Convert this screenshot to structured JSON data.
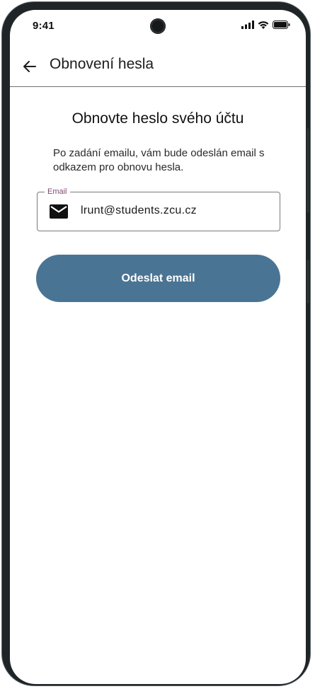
{
  "status_bar": {
    "time": "9:41"
  },
  "app_bar": {
    "back_icon": "arrow-left-icon",
    "title": "Obnovení hesla"
  },
  "content": {
    "heading": "Obnovte heslo svého účtu",
    "description": "Po zadání emailu, vám bude odeslán email s odkazem pro obnovu hesla."
  },
  "email_field": {
    "label": "Email",
    "icon": "mail-icon",
    "value": "lrunt@students.zcu.cz"
  },
  "submit_button": {
    "label": "Odeslat email"
  },
  "colors": {
    "primary": "#4a7494",
    "field_label": "#7d4b72",
    "frame": "#1f2427"
  }
}
